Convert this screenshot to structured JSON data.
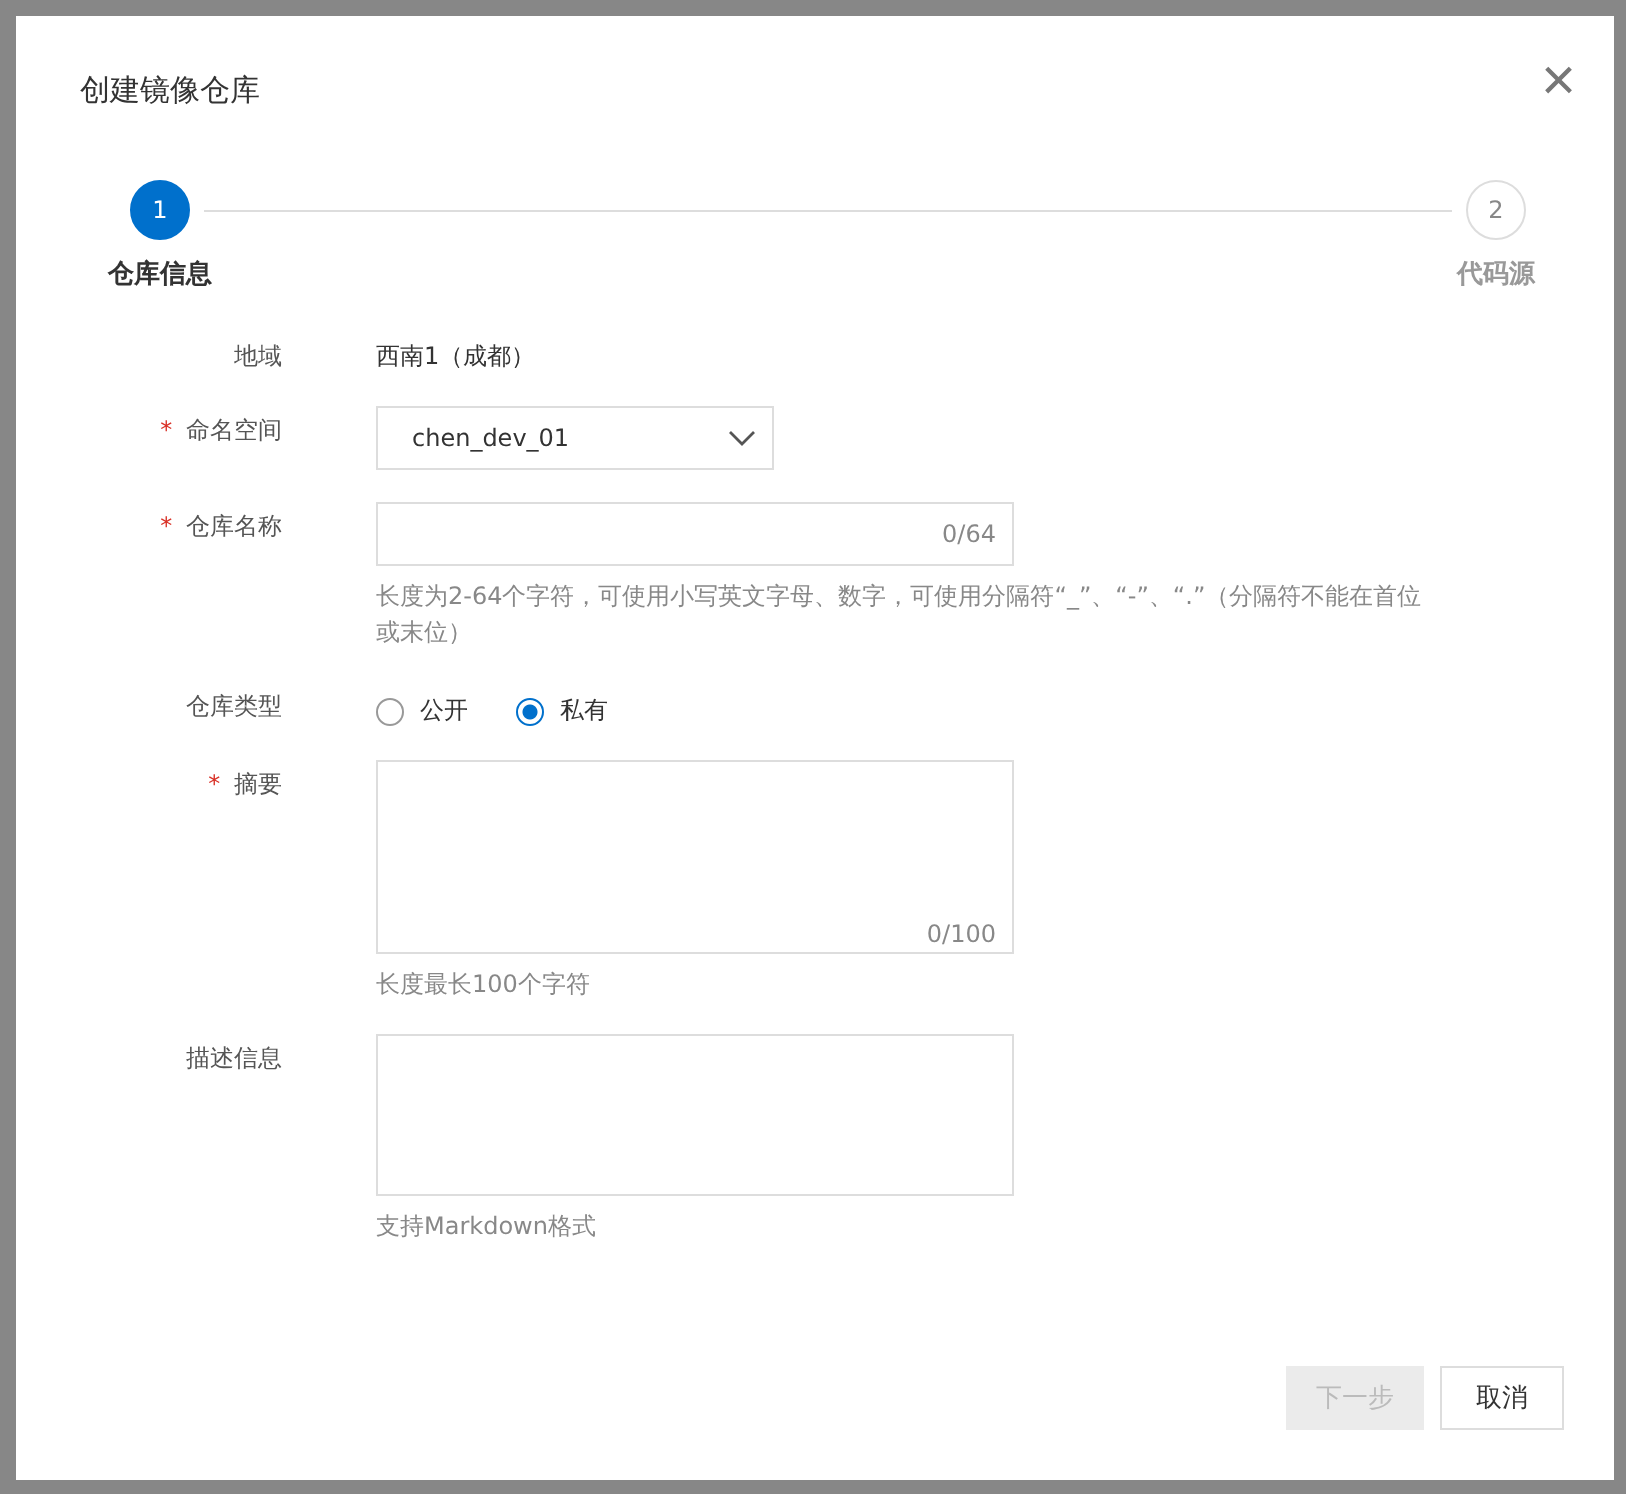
{
  "dialog": {
    "title": "创建镜像仓库",
    "close": "×"
  },
  "steps": [
    {
      "number": "1",
      "label": "仓库信息",
      "selected": true
    },
    {
      "number": "2",
      "label": "代码源",
      "selected": false
    }
  ],
  "form": [
    {
      "kind": "text",
      "label": "地域",
      "value": "西南1（成都）"
    },
    {
      "kind": "select",
      "label": "命名空间",
      "required_mark": "*",
      "value": "chen_dev_01"
    },
    {
      "kind": "input",
      "label": "仓库名称",
      "required_mark": "*",
      "counter": "0/64",
      "hint": "长度为2-64个字符，可使用小写英文字母、数字，可使用分隔符“_”、“-”、“.”（分隔符不能在首位或末位）"
    },
    {
      "kind": "radio",
      "label": "仓库类型",
      "options": [
        {
          "label": "公开",
          "selected": false
        },
        {
          "label": "私有",
          "selected": true
        }
      ]
    },
    {
      "kind": "textarea",
      "label": "摘要",
      "required_mark": "*",
      "counter": "0/100",
      "hint": "长度最长100个字符"
    },
    {
      "kind": "textarea",
      "label": "描述信息",
      "hint": "支持Markdown格式"
    }
  ],
  "buttons": [
    {
      "label": "下一步",
      "disabled": true
    },
    {
      "label": "取消",
      "disabled": false
    }
  ]
}
